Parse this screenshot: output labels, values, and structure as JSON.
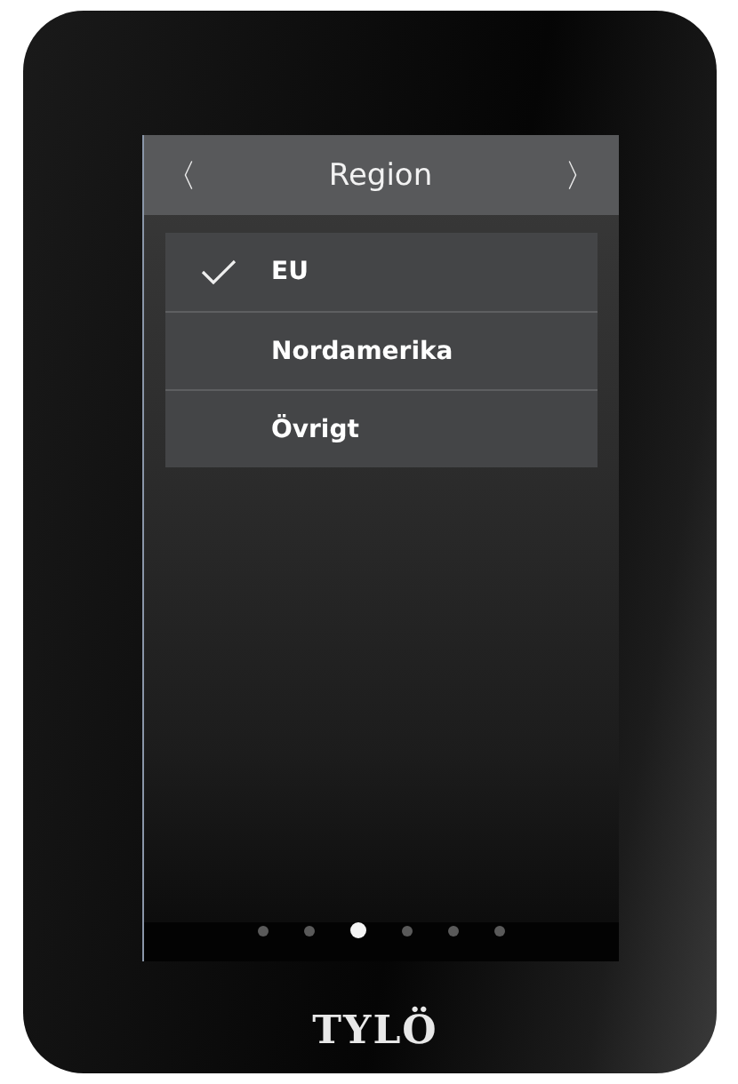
{
  "header": {
    "prev": "〈",
    "title": "Region",
    "next": "〉"
  },
  "options": [
    {
      "label": "EU",
      "selected": true
    },
    {
      "label": "Nordamerika",
      "selected": false
    },
    {
      "label": "Övrigt",
      "selected": false
    }
  ],
  "pages": [
    {
      "selected": false
    },
    {
      "selected": false
    },
    {
      "selected": true
    },
    {
      "selected": false
    },
    {
      "selected": false
    },
    {
      "selected": false
    }
  ],
  "logo": "TYLÖ"
}
